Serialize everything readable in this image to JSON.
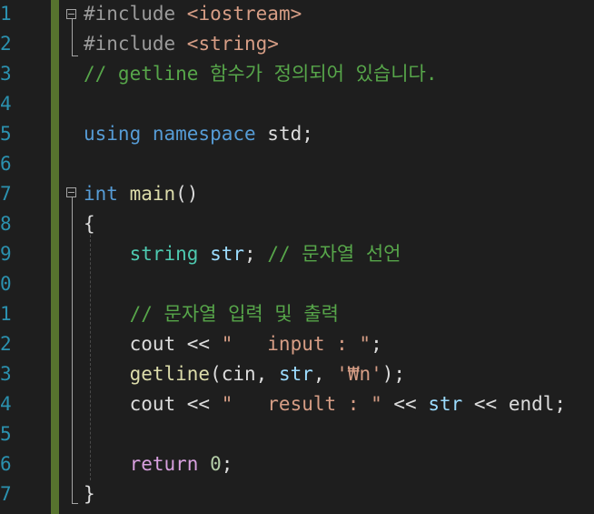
{
  "editor": {
    "line_numbers": [
      "1",
      "2",
      "3",
      "4",
      "5",
      "6",
      "7",
      "8",
      "9",
      "0",
      "1",
      "2",
      "3",
      "4",
      "5",
      "6",
      "7"
    ],
    "lines": [
      {
        "parts": [
          {
            "t": "#include ",
            "c": "pp"
          },
          {
            "t": "<iostream>",
            "c": "inc"
          }
        ]
      },
      {
        "parts": [
          {
            "t": "#include ",
            "c": "pp"
          },
          {
            "t": "<string>",
            "c": "inc"
          }
        ]
      },
      {
        "parts": [
          {
            "t": "// getline 함수가 정의되어 있습니다.",
            "c": "cm"
          }
        ]
      },
      {
        "parts": []
      },
      {
        "parts": [
          {
            "t": "using ",
            "c": "kw"
          },
          {
            "t": "namespace ",
            "c": "kw"
          },
          {
            "t": "std;",
            "c": "tx"
          }
        ]
      },
      {
        "parts": []
      },
      {
        "parts": [
          {
            "t": "int ",
            "c": "kw"
          },
          {
            "t": "main",
            "c": "fn"
          },
          {
            "t": "()",
            "c": "tx"
          }
        ]
      },
      {
        "parts": [
          {
            "t": "{",
            "c": "tx"
          }
        ]
      },
      {
        "parts": [
          {
            "t": "    ",
            "c": "tx"
          },
          {
            "t": "string ",
            "c": "ty"
          },
          {
            "t": "str",
            "c": "var"
          },
          {
            "t": "; ",
            "c": "tx"
          },
          {
            "t": "// 문자열 선언",
            "c": "cm"
          }
        ]
      },
      {
        "parts": []
      },
      {
        "parts": [
          {
            "t": "    ",
            "c": "tx"
          },
          {
            "t": "// 문자열 입력 및 출력",
            "c": "cm"
          }
        ]
      },
      {
        "parts": [
          {
            "t": "    cout << ",
            "c": "tx"
          },
          {
            "t": "\"   input : \"",
            "c": "st"
          },
          {
            "t": ";",
            "c": "tx"
          }
        ]
      },
      {
        "parts": [
          {
            "t": "    ",
            "c": "tx"
          },
          {
            "t": "getline",
            "c": "fn"
          },
          {
            "t": "(cin, ",
            "c": "tx"
          },
          {
            "t": "str",
            "c": "var"
          },
          {
            "t": ", ",
            "c": "tx"
          },
          {
            "t": "'₩n'",
            "c": "st"
          },
          {
            "t": ");",
            "c": "tx"
          }
        ]
      },
      {
        "parts": [
          {
            "t": "    cout << ",
            "c": "tx"
          },
          {
            "t": "\"   result : \"",
            "c": "st"
          },
          {
            "t": " << ",
            "c": "tx"
          },
          {
            "t": "str",
            "c": "var"
          },
          {
            "t": " << endl;",
            "c": "tx"
          }
        ]
      },
      {
        "parts": []
      },
      {
        "parts": [
          {
            "t": "    ",
            "c": "tx"
          },
          {
            "t": "return ",
            "c": "ret"
          },
          {
            "t": "0",
            "c": "num"
          },
          {
            "t": ";",
            "c": "tx"
          }
        ]
      },
      {
        "parts": [
          {
            "t": "}",
            "c": "tx"
          }
        ]
      }
    ],
    "colors": {
      "background": "#1e1e1e",
      "line_number": "#2b91af",
      "change_bar": "#57732e",
      "comment": "#57a64a",
      "keyword": "#569cd6",
      "type": "#4ec9b0",
      "string": "#d69d85",
      "function": "#dcdcaa"
    }
  }
}
